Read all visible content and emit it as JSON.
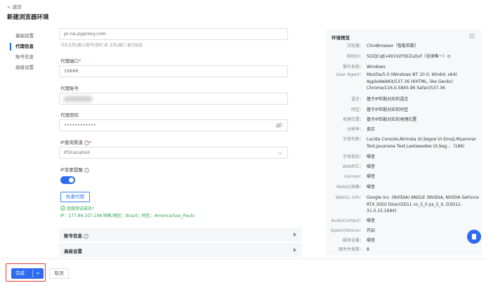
{
  "header": {
    "back_label": "< 返回",
    "title": "新建浏览器环境"
  },
  "nav": {
    "items": [
      {
        "label": "基础设置",
        "active": false
      },
      {
        "label": "代理信息",
        "active": true
      },
      {
        "label": "账号信息",
        "active": false
      },
      {
        "label": "高级设置",
        "active": false
      }
    ]
  },
  "form": {
    "proxy_host_value": "pr-na.pyproxy.com",
    "proxy_host_hint": "可在主机|端口|账号|密码 或 主机|端口 格式粘贴",
    "proxy_port_label": "代理端口",
    "proxy_port_value": "16666",
    "proxy_account_label": "代理账号",
    "proxy_password_label": "代理密码",
    "proxy_password_value": "••••••••••••",
    "ip_channel_label": "IP查询渠道",
    "ip_channel_value": "IP2Location",
    "ip_change_label": "IP变更提醒",
    "ip_change_enabled": true,
    "check_button": "检查代理",
    "check_result": "连接测试成功！",
    "ip_info": "IP：177.86.107.198 国家/地区：Brazil；时区：America/Sao_Paulo",
    "required_mark": "*",
    "help_icon_text": "?"
  },
  "sections": {
    "account": "账号信息",
    "advanced": "高级设置"
  },
  "preview": {
    "title": "环境预览",
    "rows": [
      {
        "k": "浏览器：",
        "v": "ChroBrowser（智能匹配）"
      },
      {
        "k": "指纹ID：",
        "v": "SOZJCqEv491V2FSEZuDuf（全球唯一）⊙"
      },
      {
        "k": "操作系统：",
        "v": "Windows"
      },
      {
        "k": "User Agent：",
        "v": "Mozilla/5.0 (Windows NT 10.0; Win64; x64) AppleWebKit/537.36 (KHTML, like Gecko) Chrome/116.0.5845.96 Safari/537.36"
      },
      {
        "k": "语言：",
        "v": "基于IP匹配对应的语言"
      },
      {
        "k": "时区：",
        "v": "基于IP匹配对应的时区"
      },
      {
        "k": "地理位置：",
        "v": "基于IP匹配对应的地理位置"
      },
      {
        "k": "分辨率：",
        "v": "真实"
      },
      {
        "k": "字体列表：",
        "v": "Lucida Console,Nirmala UI,Segoe UI Emoji,Myanmar Text,Javanese Text,Leelawadee UI,Seg...（186）"
      },
      {
        "k": "字体指纹：",
        "v": "噪音"
      },
      {
        "k": "WebRTC：",
        "v": "噪音"
      },
      {
        "k": "Canvas：",
        "v": "噪音"
      },
      {
        "k": "WebGL图像：",
        "v": "噪音"
      },
      {
        "k": "WebGL Info：",
        "v": "Google Inc. (NVIDIA) ANGLE (NVIDIA, NVIDIA GeForce RTX 3050 Direct3D11 vs_5_0 ps_5_0, D3D11-31.0.15.1694)"
      },
      {
        "k": "AudioContext：",
        "v": "噪音"
      },
      {
        "k": "SpeechVoices：",
        "v": "开启"
      },
      {
        "k": "媒体设备：",
        "v": "噪音"
      },
      {
        "k": "硬件并发数：",
        "v": "8"
      }
    ]
  },
  "footer": {
    "confirm": "完成",
    "cancel": "取消"
  },
  "colors": {
    "accent": "#2d6cf0",
    "success": "#2aa44a",
    "highlight": "#e53935"
  }
}
